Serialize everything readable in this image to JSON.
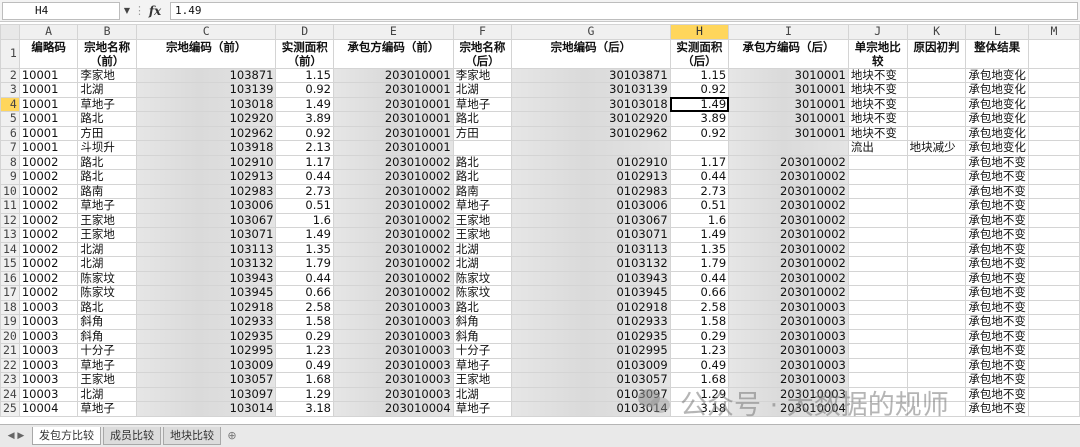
{
  "formula_bar": {
    "cell_ref": "H4",
    "fx_label": "fx",
    "value": "1.49"
  },
  "columns": [
    "A",
    "B",
    "C",
    "D",
    "E",
    "F",
    "G",
    "H",
    "I",
    "J",
    "K",
    "L",
    "M"
  ],
  "row_numbers": [
    "1",
    "2",
    "3",
    "4",
    "5",
    "6",
    "7",
    "8",
    "9",
    "10",
    "11",
    "12",
    "13",
    "14",
    "15",
    "16",
    "17",
    "18",
    "19",
    "20",
    "21",
    "22",
    "23",
    "24",
    "25"
  ],
  "headers": [
    "编略码",
    "宗地名称（前）",
    "宗地编码（前）",
    "实测面积（前）",
    "承包方编码（前）",
    "宗地名称（后）",
    "宗地编码（后）",
    "实测面积（后）",
    "承包方编码（后）",
    "单宗地比较",
    "原因初判",
    "整体结果",
    ""
  ],
  "rows": [
    [
      "10001",
      "李家地",
      "103871",
      "1.15",
      "203010001",
      "李家地",
      "30103871",
      "1.15",
      "3010001",
      "地块不变",
      "",
      "承包地变化"
    ],
    [
      "10001",
      "北湖",
      "103139",
      "0.92",
      "203010001",
      "北湖",
      "30103139",
      "0.92",
      "3010001",
      "地块不变",
      "",
      "承包地变化"
    ],
    [
      "10001",
      "草地子",
      "103018",
      "1.49",
      "203010001",
      "草地子",
      "30103018",
      "1.49",
      "3010001",
      "地块不变",
      "",
      "承包地变化"
    ],
    [
      "10001",
      "路北",
      "102920",
      "3.89",
      "203010001",
      "路北",
      "30102920",
      "3.89",
      "3010001",
      "地块不变",
      "",
      "承包地变化"
    ],
    [
      "10001",
      "方田",
      "102962",
      "0.92",
      "203010001",
      "方田",
      "30102962",
      "0.92",
      "3010001",
      "地块不变",
      "",
      "承包地变化"
    ],
    [
      "10001",
      "斗坝升",
      "103918",
      "2.13",
      "203010001",
      "",
      "",
      "",
      "",
      "流出",
      "地块减少",
      "承包地变化"
    ],
    [
      "10002",
      "路北",
      "102910",
      "1.17",
      "203010002",
      "路北",
      "0102910",
      "1.17",
      "203010002",
      "",
      "",
      "承包地不变"
    ],
    [
      "10002",
      "路北",
      "102913",
      "0.44",
      "203010002",
      "路北",
      "0102913",
      "0.44",
      "203010002",
      "",
      "",
      "承包地不变"
    ],
    [
      "10002",
      "路南",
      "102983",
      "2.73",
      "203010002",
      "路南",
      "0102983",
      "2.73",
      "203010002",
      "",
      "",
      "承包地不变"
    ],
    [
      "10002",
      "草地子",
      "103006",
      "0.51",
      "203010002",
      "草地子",
      "0103006",
      "0.51",
      "203010002",
      "",
      "",
      "承包地不变"
    ],
    [
      "10002",
      "王家地",
      "103067",
      "1.6",
      "203010002",
      "王家地",
      "0103067",
      "1.6",
      "203010002",
      "",
      "",
      "承包地不变"
    ],
    [
      "10002",
      "王家地",
      "103071",
      "1.49",
      "203010002",
      "王家地",
      "0103071",
      "1.49",
      "203010002",
      "",
      "",
      "承包地不变"
    ],
    [
      "10002",
      "北湖",
      "103113",
      "1.35",
      "203010002",
      "北湖",
      "0103113",
      "1.35",
      "203010002",
      "",
      "",
      "承包地不变"
    ],
    [
      "10002",
      "北湖",
      "103132",
      "1.79",
      "203010002",
      "北湖",
      "0103132",
      "1.79",
      "203010002",
      "",
      "",
      "承包地不变"
    ],
    [
      "10002",
      "陈家坟",
      "103943",
      "0.44",
      "203010002",
      "陈家坟",
      "0103943",
      "0.44",
      "203010002",
      "",
      "",
      "承包地不变"
    ],
    [
      "10002",
      "陈家坟",
      "103945",
      "0.66",
      "203010002",
      "陈家坟",
      "0103945",
      "0.66",
      "203010002",
      "",
      "",
      "承包地不变"
    ],
    [
      "10003",
      "路北",
      "102918",
      "2.58",
      "203010003",
      "路北",
      "0102918",
      "2.58",
      "203010003",
      "",
      "",
      "承包地不变"
    ],
    [
      "10003",
      "斜角",
      "102933",
      "1.58",
      "203010003",
      "斜角",
      "0102933",
      "1.58",
      "203010003",
      "",
      "",
      "承包地不变"
    ],
    [
      "10003",
      "斜角",
      "102935",
      "0.29",
      "203010003",
      "斜角",
      "0102935",
      "0.29",
      "203010003",
      "",
      "",
      "承包地不变"
    ],
    [
      "10003",
      "十分子",
      "102995",
      "1.23",
      "203010003",
      "十分子",
      "0102995",
      "1.23",
      "203010003",
      "",
      "",
      "承包地不变"
    ],
    [
      "10003",
      "草地子",
      "103009",
      "0.49",
      "203010003",
      "草地子",
      "0103009",
      "0.49",
      "203010003",
      "",
      "",
      "承包地不变"
    ],
    [
      "10003",
      "王家地",
      "103057",
      "1.68",
      "203010003",
      "王家地",
      "0103057",
      "1.68",
      "203010003",
      "",
      "",
      "承包地不变"
    ],
    [
      "10003",
      "北湖",
      "103097",
      "1.29",
      "203010003",
      "北湖",
      "0103097",
      "1.29",
      "203010003",
      "",
      "",
      "承包地不变"
    ],
    [
      "10004",
      "草地子",
      "103014",
      "3.18",
      "203010004",
      "草地子",
      "0103014",
      "3.18",
      "203010004",
      "",
      "",
      "承包地不变"
    ]
  ],
  "sheet_tabs": [
    "发包方比较",
    "成员比较",
    "地块比较"
  ],
  "watermark": "公众号 · 大数据的规师"
}
